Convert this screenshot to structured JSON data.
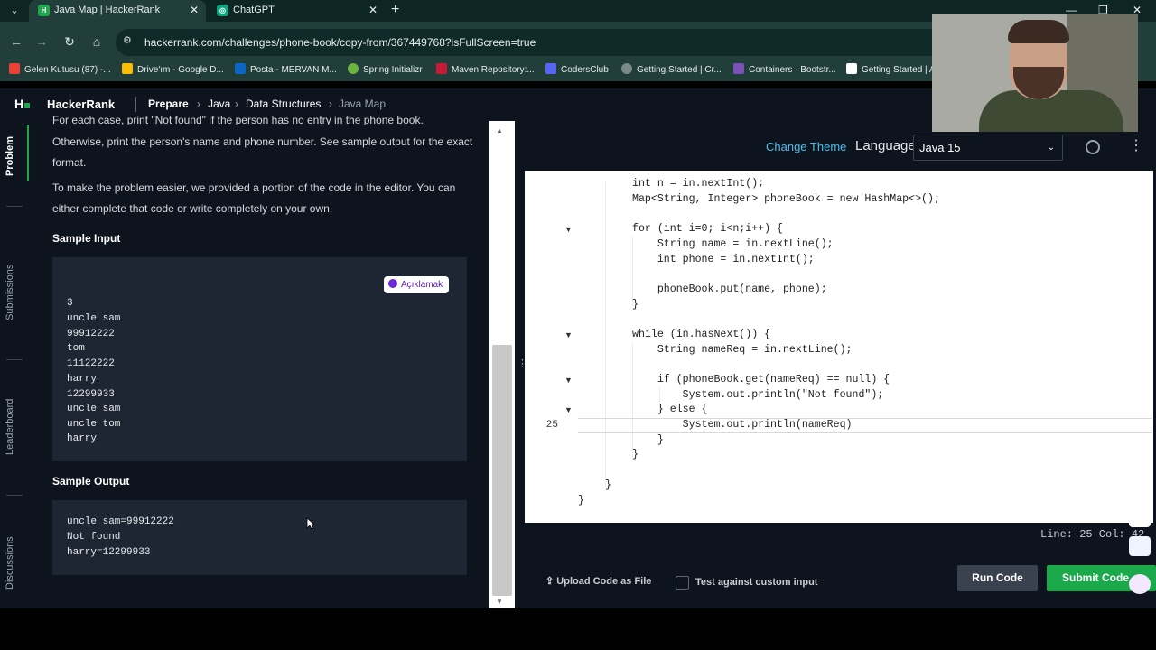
{
  "browser": {
    "tabs": [
      {
        "title": "Java Map | HackerRank",
        "icon": "hackerrank-favicon",
        "active": true
      },
      {
        "title": "ChatGPT",
        "icon": "chatgpt-favicon",
        "active": false
      }
    ],
    "url": "hackerrank.com/challenges/phone-book/copy-from/367449768?isFullScreen=true",
    "bookmarks": [
      "Gelen Kutusu (87) -...",
      "Drive'ım - Google D...",
      "Posta - MERVAN M...",
      "Spring Initializr",
      "Maven Repository:...",
      "CodersClub",
      "Getting Started | Cr...",
      "Containers · Bootstr...",
      "Getting Started | A"
    ]
  },
  "header": {
    "brand": "HackerRank",
    "breadcrumb": [
      "Prepare",
      "Java",
      "Data Structures",
      "Java Map"
    ]
  },
  "rail": {
    "items": [
      "Problem",
      "Submissions",
      "Leaderboard",
      "Discussions"
    ]
  },
  "problem": {
    "para_top_cut": "For each case, print \"Not found\" if the person has no entry in the phone book.",
    "para1": "Otherwise, print the person's name and phone number. See sample output for the exact format.",
    "para2": "To make the problem easier, we provided a portion of the code in the editor. You can either complete that code or write completely on your own.",
    "sample_input_title": "Sample Input",
    "sample_input": [
      "3",
      "uncle sam",
      "99912222",
      "tom",
      "11122222",
      "harry",
      "12299933",
      "uncle sam",
      "uncle tom",
      "harry"
    ],
    "explain_button": "Açıklamak",
    "sample_output_title": "Sample Output",
    "sample_output": [
      "uncle sam=99912222",
      "Not found",
      "harry=12299933"
    ]
  },
  "editor": {
    "change_theme": "Change Theme",
    "language_label": "Language",
    "language_value": "Java 15",
    "current_line_number": "25",
    "code_lines": [
      "int n = in.nextInt();",
      "Map<String, Integer> phoneBook = new HashMap<>();",
      "",
      "for (int i=0; i<n;i++) {",
      "    String name = in.nextLine();",
      "    int phone = in.nextInt();",
      "",
      "    phoneBook.put(name, phone);",
      "}",
      "",
      "while (in.hasNext()) {",
      "    String nameReq = in.nextLine();",
      "",
      "    if (phoneBook.get(nameReq) == null) {",
      "        System.out.println(\"Not found\");",
      "    } else {",
      "        System.out.println(nameReq)",
      "    }",
      "}",
      "",
      "}",
      "}"
    ],
    "status": "Line: 25 Col: 42"
  },
  "footer": {
    "upload": "Upload Code as File",
    "test_custom": "Test against custom input",
    "run": "Run Code",
    "submit": "Submit Code"
  }
}
